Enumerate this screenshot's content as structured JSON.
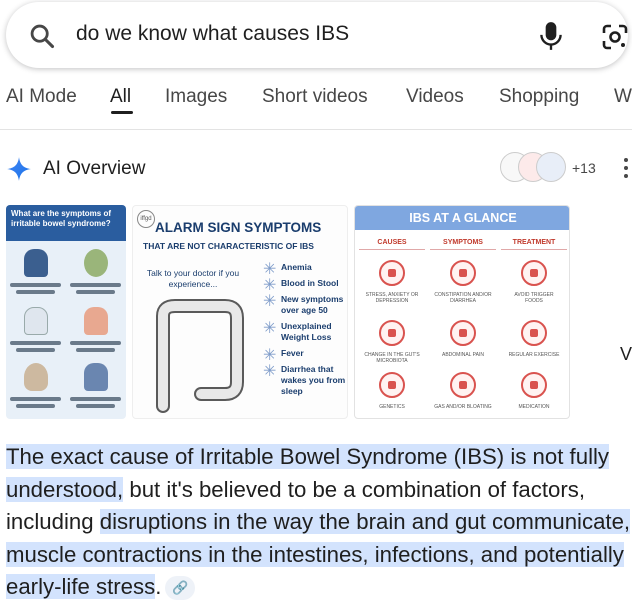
{
  "search": {
    "query": "do we know what causes IBS"
  },
  "tabs": [
    {
      "label": "AI Mode"
    },
    {
      "label": "All"
    },
    {
      "label": "Images"
    },
    {
      "label": "Short videos"
    },
    {
      "label": "Videos"
    },
    {
      "label": "Shopping"
    },
    {
      "label": "W"
    }
  ],
  "active_tab": "All",
  "ai_overview": {
    "title": "AI Overview",
    "more_sources": "+13",
    "side_text": "V"
  },
  "images": {
    "card1": {
      "heading": "What are the symptoms of irritable bowel syndrome?"
    },
    "card2": {
      "logo": "iffgd",
      "title": "ALARM SIGN SYMPTOMS",
      "subtitle": "THAT ARE NOT CHARACTERISTIC OF IBS",
      "talk": "Talk to your doctor if you experience...",
      "items": [
        "Anemia",
        "Blood in Stool",
        "New symptoms over age 50",
        "Unexplained Weight Loss",
        "Fever",
        "Diarrhea that wakes you from sleep"
      ]
    },
    "card3": {
      "title": "IBS AT A GLANCE",
      "columns": [
        "CAUSES",
        "SYMPTOMS",
        "TREATMENT"
      ],
      "rows": [
        [
          "STRESS, ANXIETY OR DEPRESSION",
          "CONSTIPATION AND/OR DIARRHEA",
          "AVOID TRIGGER FOODS"
        ],
        [
          "CHANGE IN THE GUT'S MICROBIOTA",
          "ABDOMINAL PAIN",
          "REGULAR EXERCISE"
        ],
        [
          "GENETICS",
          "GAS AND/OR BLOATING",
          "MEDICATION"
        ]
      ]
    }
  },
  "answer": {
    "part1": "The exact cause of Irritable Bowel Syndrome (IBS) is not fully understood,",
    "part2": " but it's believed to be a combination of factors, including ",
    "part3": "disruptions in the way the brain and gut communicate, muscle contractions in the intestines, infections, and potentially early-life stress",
    "part4": "."
  },
  "colors": {
    "highlight": "#d3e3fd",
    "accent_blue": "#1a73e8",
    "ibs_red": "#d9534f"
  }
}
